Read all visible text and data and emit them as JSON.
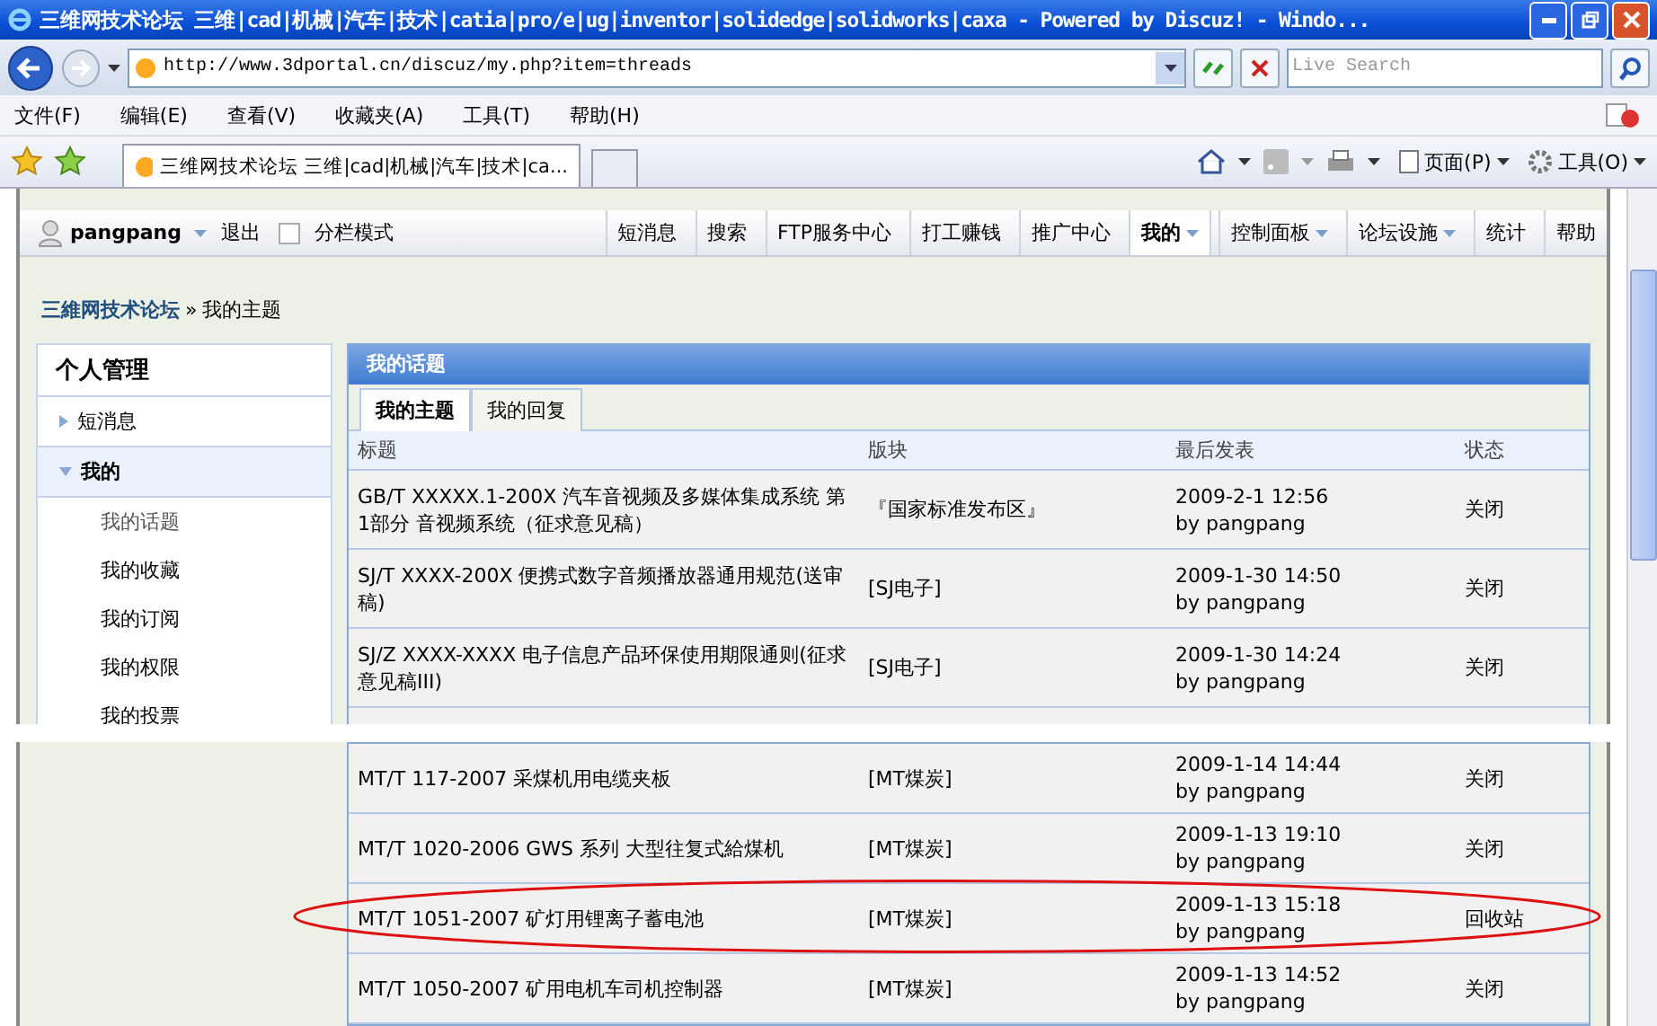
{
  "window": {
    "title": "三维网技术论坛 三维|cad|机械|汽车|技术|catia|pro/e|ug|inventor|solidedge|solidworks|caxa - Powered by Discuz! - Windo..."
  },
  "browser": {
    "address": "http://www.3dportal.cn/discuz/my.php?item=threads",
    "search_placeholder": "Live Search",
    "menu": [
      "文件(F)",
      "编辑(E)",
      "查看(V)",
      "收藏夹(A)",
      "工具(T)",
      "帮助(H)"
    ],
    "tab": "三维网技术论坛 三维|cad|机械|汽车|技术|ca...",
    "tools": [
      "页面(P)",
      "工具(O)"
    ]
  },
  "forum": {
    "user": "pangpang",
    "logout": "退出",
    "split_mode": {
      "label": "分栏模式",
      "checked": false
    },
    "nav": [
      {
        "label": "短消息",
        "selected": false,
        "dropdown": false
      },
      {
        "label": "搜索",
        "selected": false,
        "dropdown": false
      },
      {
        "label": "FTP服务中心",
        "selected": false,
        "dropdown": false
      },
      {
        "label": "打工赚钱",
        "selected": false,
        "dropdown": false
      },
      {
        "label": "推广中心",
        "selected": false,
        "dropdown": false
      },
      {
        "label": "我的",
        "selected": true,
        "dropdown": true
      },
      {
        "label": "控制面板",
        "selected": false,
        "dropdown": true
      },
      {
        "label": "论坛设施",
        "selected": false,
        "dropdown": true
      },
      {
        "label": "统计",
        "selected": false,
        "dropdown": false
      },
      {
        "label": "帮助",
        "selected": false,
        "dropdown": false
      }
    ],
    "breadcrumb": {
      "link": "三維网技术论坛",
      "separator": "»",
      "current": "我的主题"
    },
    "sidebar": {
      "title": "个人管理",
      "items": [
        {
          "label": "短消息",
          "expanded": false
        },
        {
          "label": "我的",
          "expanded": true,
          "children": [
            {
              "label": "我的话题",
              "selected": true
            },
            {
              "label": "我的收藏",
              "selected": false
            },
            {
              "label": "我的订阅",
              "selected": false
            },
            {
              "label": "我的权限",
              "selected": false
            },
            {
              "label": "我的投票",
              "selected": false
            }
          ]
        }
      ]
    },
    "panel": {
      "title": "我的话题",
      "tabs": [
        {
          "label": "我的主题",
          "selected": true
        },
        {
          "label": "我的回复",
          "selected": false
        }
      ],
      "columns": [
        "标题",
        "版块",
        "最后发表",
        "状态"
      ],
      "rows": [
        {
          "title": "GB/T XXXXX.1-200X 汽车音视频及多媒体集成系统 第1部分 音视频系统（征求意见稿）",
          "forum": "『国家标准发布区』",
          "date": "2009-2-1 12:56",
          "by": "by pangpang",
          "status": "关闭",
          "circled": false
        },
        {
          "title": "SJ/T XXXX-200X 便携式数字音频播放器通用规范(送审稿)",
          "forum": "[SJ电子]",
          "date": "2009-1-30 14:50",
          "by": "by pangpang",
          "status": "关闭",
          "circled": false
        },
        {
          "title": "SJ/Z XXXX-XXXX 电子信息产品环保使用期限通则(征求意见稿III)",
          "forum": "[SJ电子]",
          "date": "2009-1-30 14:24",
          "by": "by pangpang",
          "status": "关闭",
          "circled": false
        }
      ],
      "rows_lower": [
        {
          "title": "MT/T 117-2007 采煤机用电缆夹板",
          "forum": "[MT煤炭]",
          "date": "2009-1-14 14:44",
          "by": "by pangpang",
          "status": "关闭",
          "circled": false
        },
        {
          "title": "MT/T 1020-2006 GWS 系列 大型往复式給煤机",
          "forum": "[MT煤炭]",
          "date": "2009-1-13 19:10",
          "by": "by pangpang",
          "status": "关闭",
          "circled": false
        },
        {
          "title": "MT/T 1051-2007 矿灯用锂离子蓄电池",
          "forum": "[MT煤炭]",
          "date": "2009-1-13 15:18",
          "by": "by pangpang",
          "status": "回收站",
          "circled": true
        },
        {
          "title": "MT/T 1050-2007 矿用电机车司机控制器",
          "forum": "[MT煤炭]",
          "date": "2009-1-13 14:52",
          "by": "by pangpang",
          "status": "关闭",
          "circled": false
        }
      ]
    }
  }
}
